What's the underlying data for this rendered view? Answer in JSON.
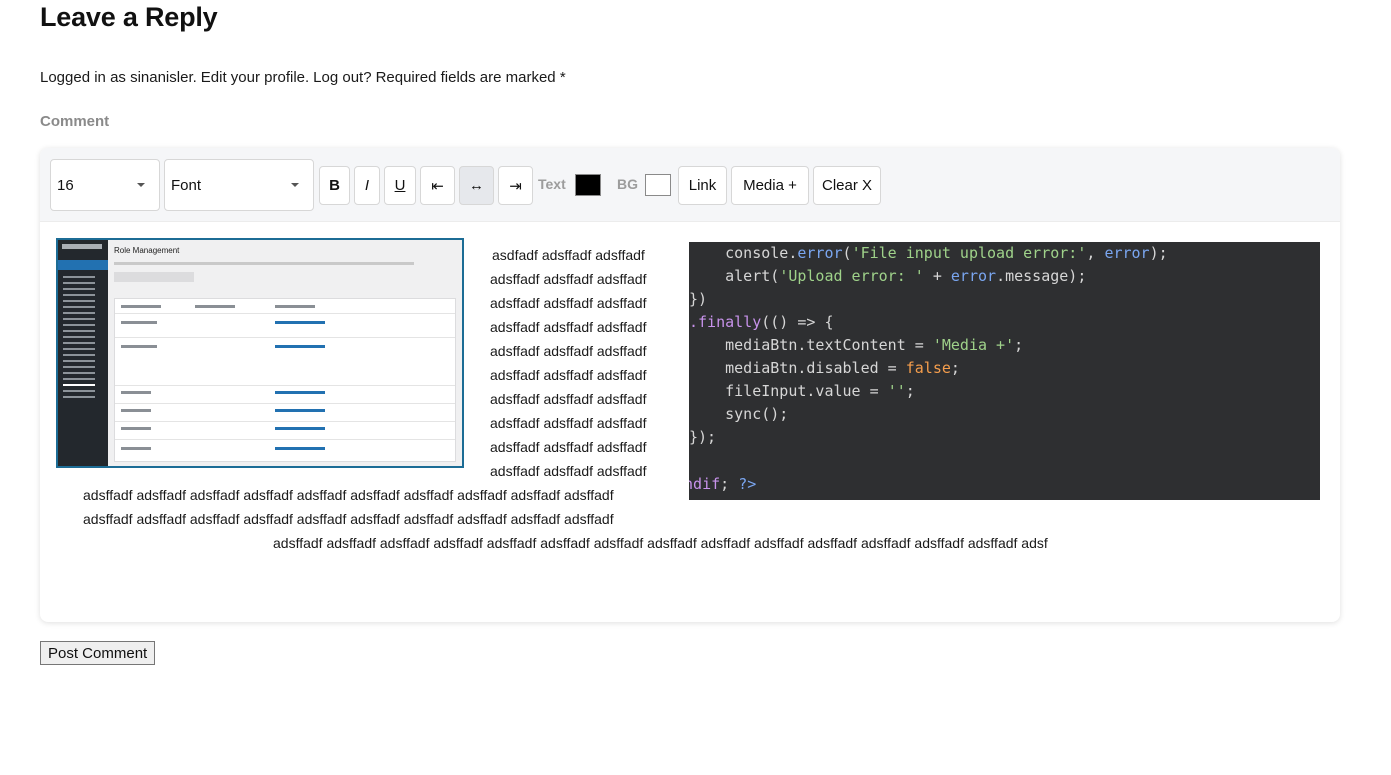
{
  "title": "Leave a Reply",
  "logged_in": {
    "prefix": "Logged in as sinanisler.",
    "edit_profile": "Edit your profile.",
    "logout": "Log out?",
    "required": "Required fields are marked *"
  },
  "comment_label": "Comment",
  "toolbar": {
    "font_size": {
      "value": "16",
      "icon": "chevron-down-icon"
    },
    "font_family": {
      "value": "Font",
      "icon": "chevron-down-icon"
    },
    "bold": "B",
    "italic": "I",
    "underline": "U",
    "align_left": "⇤",
    "align_center": "↔",
    "align_right": "⇥",
    "text_color_label": "Text",
    "text_color": "#000000",
    "bg_color_label": "BG",
    "bg_color": "#ffffff",
    "link": "Link",
    "media": "Media +",
    "clear": "Clear X",
    "active_button": "align_center"
  },
  "content": {
    "embedded_image": {
      "heading": "Role Management",
      "accent_color": "#1c6c95"
    },
    "wrapped_lines": [
      "asdfadf adsffadf adsffadf",
      "adsffadf adsffadf adsffadf",
      "adsffadf adsffadf adsffadf",
      "adsffadf adsffadf adsffadf",
      "adsffadf adsffadf adsffadf",
      "adsffadf adsffadf adsffadf",
      "adsffadf adsffadf adsffadf",
      "adsffadf adsffadf adsffadf",
      "adsffadf adsffadf adsffadf",
      "adsffadf adsffadf adsffadf"
    ],
    "full_lines": [
      "adsffadf adsffadf adsffadf adsffadf adsffadf adsffadf adsffadf adsffadf adsffadf adsffadf",
      "adsffadf adsffadf adsffadf adsffadf adsffadf adsffadf adsffadf adsffadf adsffadf adsffadf",
      "adsffadf adsffadf adsffadf adsffadf adsffadf adsffadf adsffadf adsffadf adsffadf adsffadf adsffadf adsffadf adsffadf adsffadf adsf"
    ],
    "code": {
      "background": "#2e2f31",
      "line1": {
        "indent": "    ",
        "a": "console.",
        "b": "error",
        "c": "(",
        "d": "'File input upload error:'",
        "e": ", ",
        "f": "error",
        "g": ");"
      },
      "line2": {
        "indent": "    ",
        "a": "alert(",
        "b": "'Upload error: '",
        "c": " + ",
        "d": "error",
        "e": ".message);"
      },
      "line3": "})",
      "line4": {
        "a": ".finally",
        "b": "(() => {"
      },
      "line5": {
        "indent": "    ",
        "a": "mediaBtn.textContent = ",
        "b": "'Media +'",
        "c": ";"
      },
      "line6": {
        "indent": "    ",
        "a": "mediaBtn.disabled = ",
        "b": "false",
        "c": ";"
      },
      "line7": {
        "indent": "    ",
        "a": "fileInput.value = ",
        "b": "''",
        "c": ";"
      },
      "line8": {
        "indent": "    ",
        "a": "sync();"
      },
      "line9": "});",
      "line10": {
        "a": "endif",
        "b": "; ",
        "c": "?>"
      }
    }
  },
  "submit": "Post Comment"
}
